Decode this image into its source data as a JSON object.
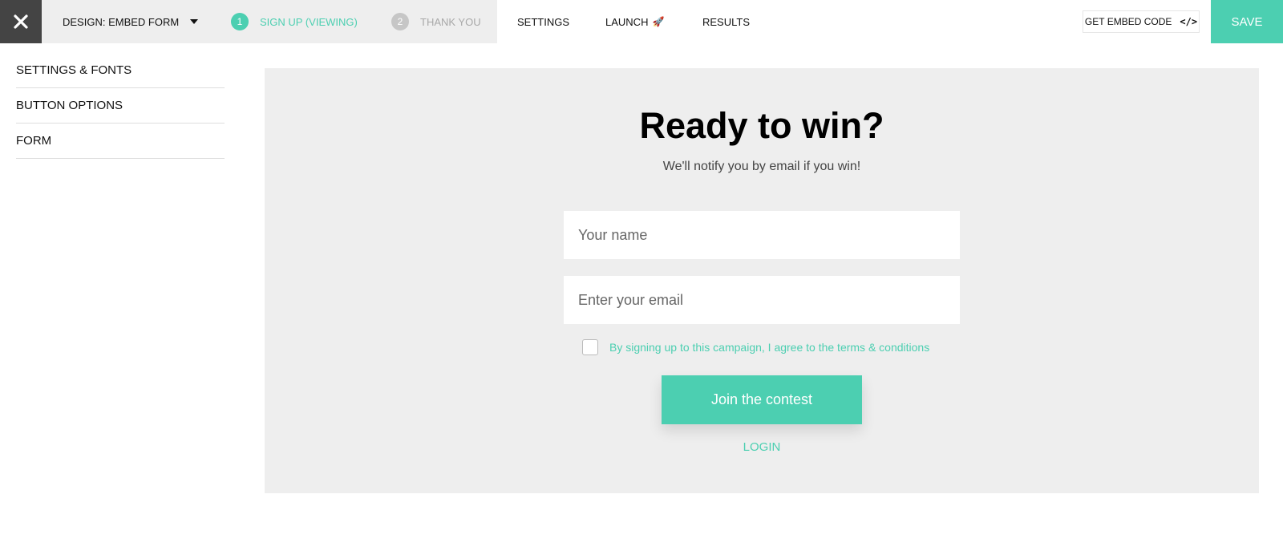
{
  "topbar": {
    "close_icon": "close-icon",
    "design_dropdown": "DESIGN: EMBED FORM",
    "steps": [
      {
        "number": "1",
        "label": "SIGN UP (VIEWING)",
        "active": true
      },
      {
        "number": "2",
        "label": "THANK YOU",
        "active": false
      }
    ],
    "nav": {
      "settings": "SETTINGS",
      "launch": "LAUNCH",
      "launch_icon": "🚀",
      "results": "RESULTS"
    },
    "embed_button": "GET EMBED CODE",
    "embed_icon": "</>",
    "save_button": "SAVE"
  },
  "sidebar": {
    "items": [
      {
        "label": "SETTINGS & FONTS"
      },
      {
        "label": "BUTTON OPTIONS"
      },
      {
        "label": "FORM"
      }
    ]
  },
  "form": {
    "title": "Ready to win?",
    "subtitle": "We'll notify you by email if you win!",
    "name_placeholder": "Your name",
    "email_placeholder": "Enter your email",
    "terms_text": "By signing up to this campaign, I agree to the terms & conditions",
    "terms_checked": false,
    "submit_label": "Join the contest",
    "login_label": "LOGIN"
  },
  "colors": {
    "accent": "#4ccfb1",
    "close_bg": "#444444",
    "topbar_bg": "#eeeeee",
    "preview_bg": "#eeeeee"
  }
}
